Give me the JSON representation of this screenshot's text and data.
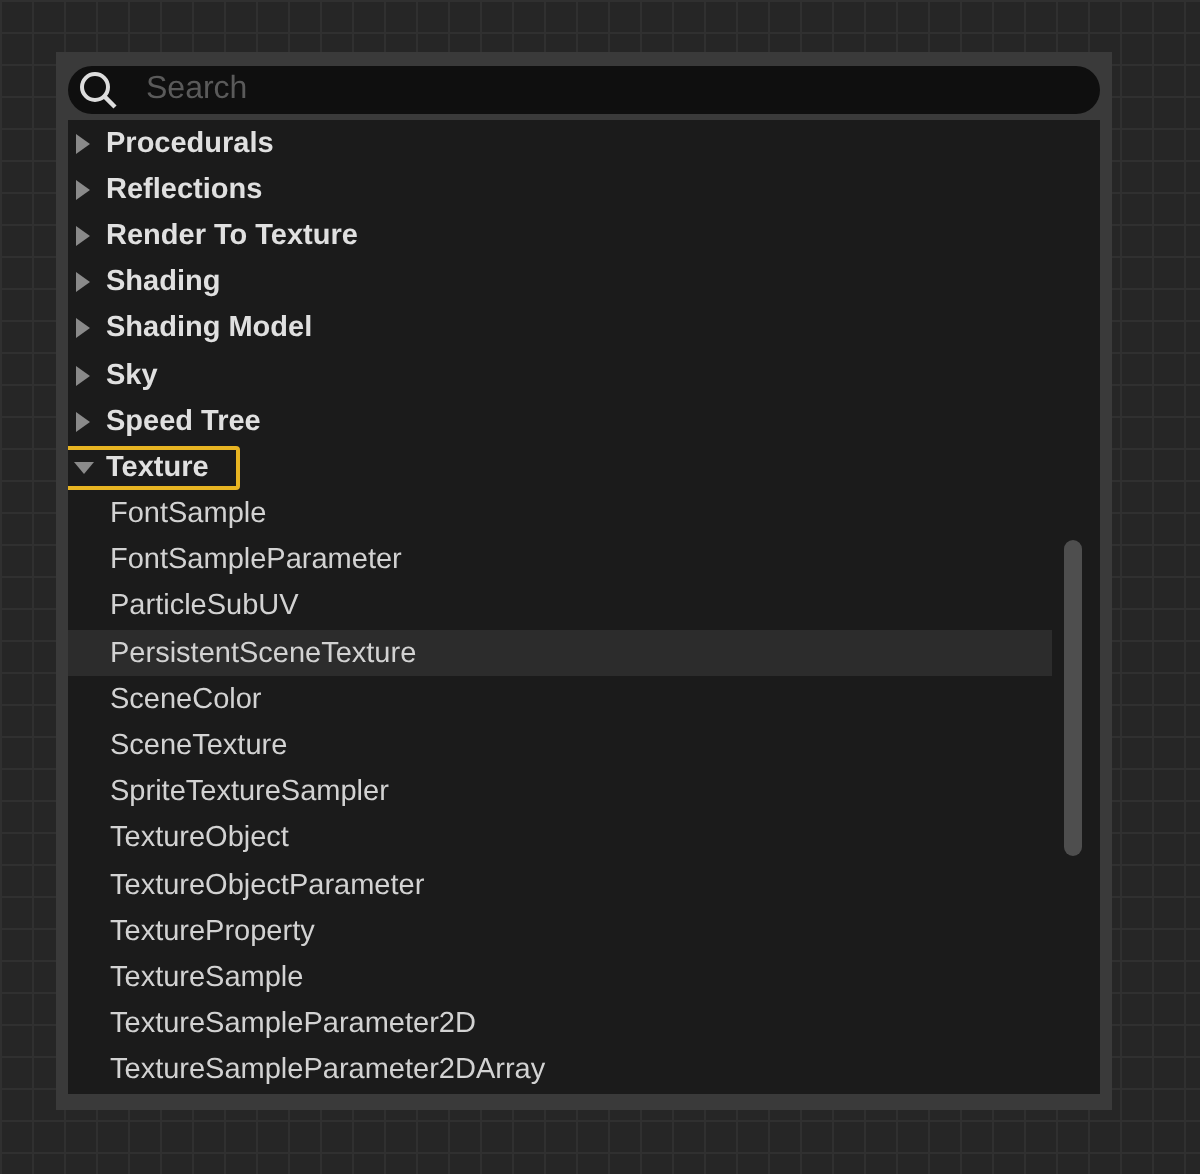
{
  "search": {
    "placeholder": "Search"
  },
  "tree": [
    {
      "label": "Procedurals",
      "expanded": false,
      "outlined": false
    },
    {
      "label": "Reflections",
      "expanded": false,
      "outlined": false
    },
    {
      "label": "Render To Texture",
      "expanded": false,
      "outlined": false
    },
    {
      "label": "Shading",
      "expanded": false,
      "outlined": false
    },
    {
      "label": "Shading Model",
      "expanded": false,
      "outlined": false
    },
    {
      "label": "Sky",
      "expanded": false,
      "outlined": false
    },
    {
      "label": "Speed Tree",
      "expanded": false,
      "outlined": false
    },
    {
      "label": "Texture",
      "expanded": true,
      "outlined": true,
      "children": [
        {
          "label": "FontSample",
          "selected": false
        },
        {
          "label": "FontSampleParameter",
          "selected": false
        },
        {
          "label": "ParticleSubUV",
          "selected": false
        },
        {
          "label": "PersistentSceneTexture",
          "selected": true
        },
        {
          "label": "SceneColor",
          "selected": false
        },
        {
          "label": "SceneTexture",
          "selected": false
        },
        {
          "label": "SpriteTextureSampler",
          "selected": false
        },
        {
          "label": "TextureObject",
          "selected": false
        },
        {
          "label": "TextureObjectParameter",
          "selected": false
        },
        {
          "label": "TextureProperty",
          "selected": false
        },
        {
          "label": "TextureSample",
          "selected": false
        },
        {
          "label": "TextureSampleParameter2D",
          "selected": false
        },
        {
          "label": "TextureSampleParameter2DArray",
          "selected": false
        }
      ]
    }
  ]
}
